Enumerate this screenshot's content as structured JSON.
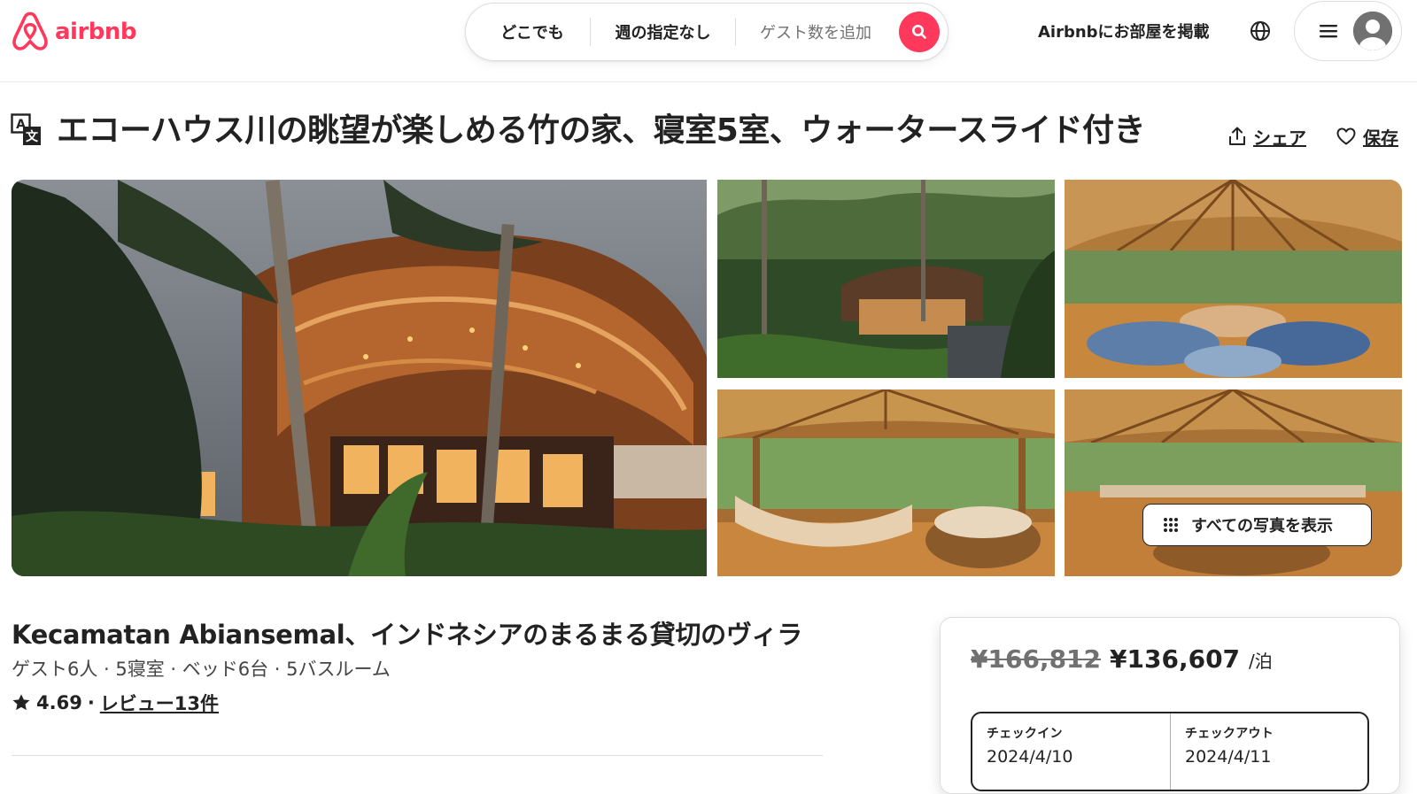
{
  "brand": {
    "name": "airbnb",
    "color": "#ff385c",
    "logo_icon": "airbnb-belo-icon"
  },
  "search": {
    "where": "どこでも",
    "when": "週の指定なし",
    "guests_placeholder": "ゲスト数を追加",
    "button_icon": "search-icon"
  },
  "header": {
    "host_link": "Airbnbにお部屋を掲載",
    "globe_icon": "globe-icon",
    "menu_icon": "hamburger-icon",
    "avatar_icon": "user-avatar-icon"
  },
  "listing": {
    "translate_icon": "translate-icon",
    "title": "エコーハウス川の眺望が楽しめる竹の家、寝室5室、ウォータースライド付き",
    "actions": {
      "share": "シェア",
      "save": "保存"
    },
    "photos": {
      "show_all": "すべての写真を表示",
      "items": [
        "main-exterior-photo",
        "jungle-villa-photo",
        "living-room-photo",
        "lounge-sofa-photo",
        "pavilion-photo"
      ]
    },
    "subtitle": "Kecamatan Abiansemal、インドネシアのまるまる貸切のヴィラ",
    "facts": "ゲスト6人 · 5寝室 · ベッド6台 · 5バスルーム",
    "rating": {
      "score": "4.69",
      "separator": "·",
      "reviews": "レビュー13件"
    }
  },
  "booking": {
    "old_price": "¥166,812",
    "new_price": "¥136,607",
    "per": "/泊",
    "checkin_label": "チェックイン",
    "checkin_value": "2024/4/10",
    "checkout_label": "チェックアウト",
    "checkout_value": "2024/4/11"
  }
}
